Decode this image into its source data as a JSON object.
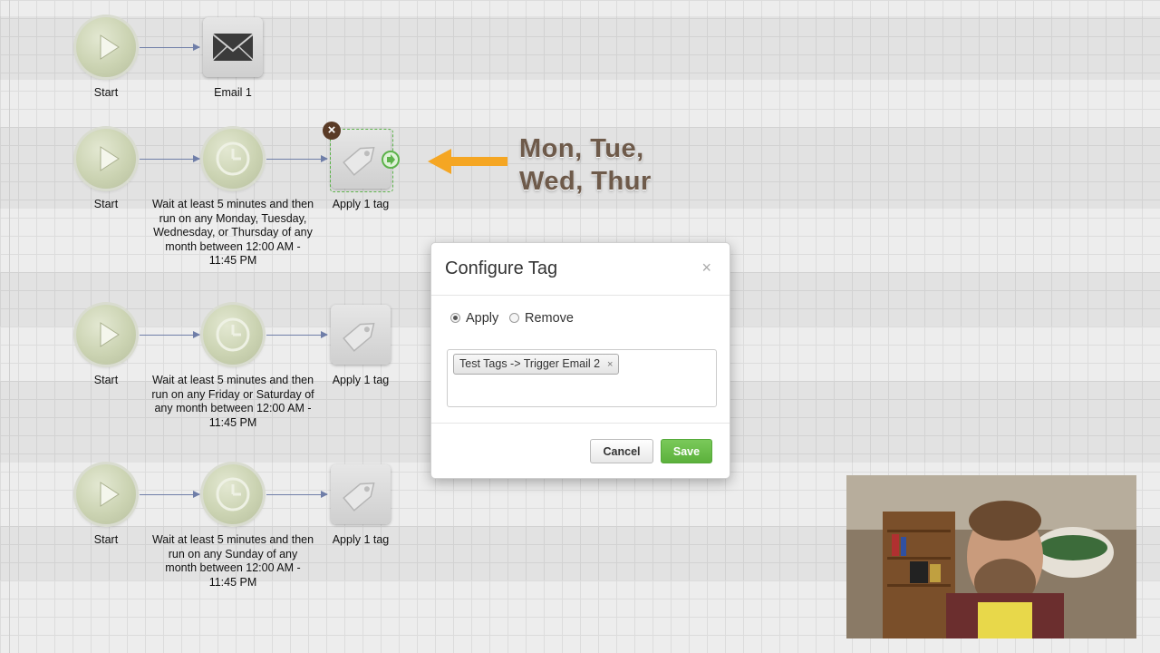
{
  "rows": [
    {
      "nodes": [
        {
          "type": "start",
          "label": "Start"
        },
        {
          "type": "email",
          "label": "Email 1"
        }
      ]
    },
    {
      "nodes": [
        {
          "type": "start",
          "label": "Start"
        },
        {
          "type": "wait",
          "label": "Wait at least 5 minutes and then run on any Monday, Tuesday, Wednesday, or Thursday of any month between 12:00 AM - 11:45 PM"
        },
        {
          "type": "tag",
          "label": "Apply 1 tag"
        }
      ]
    },
    {
      "nodes": [
        {
          "type": "start",
          "label": "Start"
        },
        {
          "type": "wait",
          "label": "Wait at least 5 minutes and then run on any Friday or Saturday of any month between 12:00 AM - 11:45 PM"
        },
        {
          "type": "tag",
          "label": "Apply 1 tag"
        }
      ]
    },
    {
      "nodes": [
        {
          "type": "start",
          "label": "Start"
        },
        {
          "type": "wait",
          "label": "Wait at least 5 minutes and then run on any Sunday of any month between 12:00 AM - 11:45 PM"
        },
        {
          "type": "tag",
          "label": "Apply 1 tag"
        }
      ]
    }
  ],
  "annotation": {
    "line1": "Mon, Tue,",
    "line2": "Wed, Thur",
    "arrow_color": "#f5a623"
  },
  "modal": {
    "title": "Configure Tag",
    "close": "×",
    "apply_label": "Apply",
    "remove_label": "Remove",
    "selected_action": "Apply",
    "tag_chip": "Test Tags -> Trigger Email 2",
    "chip_remove": "×",
    "cancel_label": "Cancel",
    "save_label": "Save"
  },
  "icons": {
    "start": "play-icon",
    "email": "envelope-icon",
    "wait": "clock-icon",
    "tag": "tag-icon",
    "delete": "delete-node-icon"
  },
  "colors": {
    "save": "#5cb13c",
    "connector": "#6f7ea8",
    "selection": "#5db34b"
  }
}
